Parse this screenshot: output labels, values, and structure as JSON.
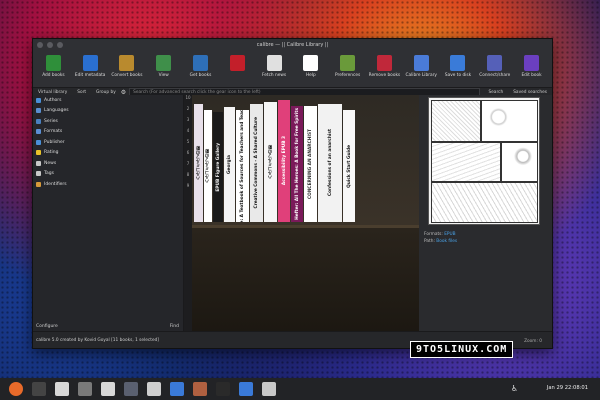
{
  "window": {
    "title": "calibre — || Calibre Library ||"
  },
  "toolbar": [
    {
      "label": "Add books",
      "color": "#2f8f3a"
    },
    {
      "label": "Edit metadata",
      "color": "#2a6fd0"
    },
    {
      "label": "Convert books",
      "color": "#b98a2e"
    },
    {
      "label": "View",
      "color": "#3f8f4a"
    },
    {
      "label": "Get books",
      "color": "#2e6fb8"
    },
    {
      "label": "",
      "color": "#c31f2a"
    },
    {
      "label": "Fetch news",
      "color": "#e0e0e0"
    },
    {
      "label": "Help",
      "color": "#ffffff"
    },
    {
      "label": "Preferences",
      "color": "#6a9a3a"
    },
    {
      "label": "Remove books",
      "color": "#c0283a"
    },
    {
      "label": "Calibre Library",
      "color": "#4a7bd8"
    },
    {
      "label": "Save to disk",
      "color": "#3a7bd8"
    },
    {
      "label": "Connect/share",
      "color": "#5560b8"
    },
    {
      "label": "Edit book",
      "color": "#6b3fc0"
    }
  ],
  "searchbar": {
    "virtual_library": "Virtual library",
    "sort": "Sort",
    "group_by": "Group by",
    "placeholder": "Search (For advanced search click the gear icon to the left)",
    "search": "Search",
    "saved": "Saved searches"
  },
  "tagbrowser": {
    "items": [
      {
        "label": "Authors",
        "color": "#4a90d8"
      },
      {
        "label": "Languages",
        "color": "#5a8fd0"
      },
      {
        "label": "Series",
        "color": "#4a80c0"
      },
      {
        "label": "Formats",
        "color": "#5c8fd4"
      },
      {
        "label": "Publisher",
        "color": "#4a90d8"
      },
      {
        "label": "Rating",
        "color": "#e8c22a"
      },
      {
        "label": "News",
        "color": "#c8c8c8"
      },
      {
        "label": "Tags",
        "color": "#c8c8c8"
      },
      {
        "label": "Identifiers",
        "color": "#d89a3a"
      }
    ],
    "configure": "Configure",
    "find": "Find"
  },
  "shelf": {
    "row_numbers": [
      "10",
      "2",
      "3",
      "4",
      "5",
      "6",
      "7",
      "8",
      "9"
    ],
    "books": [
      {
        "title": "ハルコミルフの影",
        "bg": "#e8e0ea",
        "fg": "#111"
      },
      {
        "title": "ハルコミルフの影",
        "bg": "#ffffff",
        "fg": "#111"
      },
      {
        "title": "EPUB Figure Gallery",
        "bg": "#1a1a1a",
        "fg": "#eee"
      },
      {
        "title": "Georgia",
        "bg": "#f4f4f4",
        "fg": "#111"
      },
      {
        "title": "Children's Literature: A Textbook of Sources for Teachers and Teacher-Training Classes",
        "bg": "#ffffff",
        "fg": "#111"
      },
      {
        "title": "Creative Commons - A Shared Culture",
        "bg": "#e9e9e9",
        "fg": "#111"
      },
      {
        "title": "ハルコミルフの影",
        "bg": "#f6f6f6",
        "fg": "#111"
      },
      {
        "title": "Accessibility EPUB 3",
        "bg": "#e0407a",
        "fg": "#fff"
      },
      {
        "title": "Hefter: All The Heroes: A Book for Free Spirits",
        "bg": "#7a1a5a",
        "fg": "#fff"
      },
      {
        "title": "CONCERNING AN ANARCHIST",
        "bg": "#ffffff",
        "fg": "#333"
      },
      {
        "title": "Confessions of an anarchist",
        "bg": "#f2f2f2",
        "fg": "#111"
      },
      {
        "title": "Quick Start Guide",
        "bg": "#f8f8f8",
        "fg": "#111"
      }
    ]
  },
  "details": {
    "formats_label": "Formats:",
    "formats_value": "EPUB",
    "path_label": "Path:",
    "path_value": "Book files"
  },
  "status": {
    "text": "calibre 5.0 created by Kovid Goyal    [11 books, 1 selected]",
    "zoom": "Zoom: 0"
  },
  "watermark": "9TO5LINUX.COM",
  "taskbar": {
    "apps": [
      {
        "name": "firefox",
        "color": "#e86a2a"
      },
      {
        "name": "terminal",
        "color": "#444"
      },
      {
        "name": "files",
        "color": "#d8d8d8"
      },
      {
        "name": "apps",
        "color": "#7a7a7a"
      },
      {
        "name": "text",
        "color": "#d8d8d8"
      },
      {
        "name": "monitor",
        "color": "#5a6070"
      },
      {
        "name": "screenshot",
        "color": "#cfcfcf"
      },
      {
        "name": "store",
        "color": "#3a7ad8"
      },
      {
        "name": "settings",
        "color": "#b06040"
      },
      {
        "name": "steam",
        "color": "#2a2a2a"
      },
      {
        "name": "web",
        "color": "#3a7ad8"
      },
      {
        "name": "calibre",
        "color": "#c8c8c8"
      }
    ],
    "clock": "Jan 29  22:08:01"
  }
}
